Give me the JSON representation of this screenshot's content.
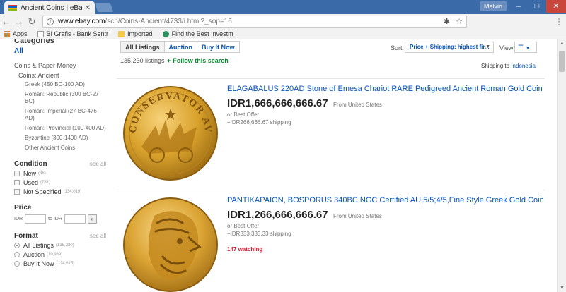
{
  "browser": {
    "tab_title": "Ancient Coins | eBay",
    "profile_name": "Melvin",
    "url_host": "www.ebay.com",
    "url_path": "/sch/Coins-Ancient/4733/i.html?_sop=16",
    "bookmarks": [
      {
        "label": "Apps"
      },
      {
        "label": "BI Grafis - Bank Sentr"
      },
      {
        "label": "Imported"
      },
      {
        "label": "Find the Best Investm"
      }
    ]
  },
  "sidebar": {
    "heading": "Categories",
    "all_label": "All",
    "category": "Coins & Paper Money",
    "subcategory": "Coins: Ancient",
    "subitems": [
      "Greek (450 BC-100 AD)",
      "Roman: Republic (300 BC-27 BC)",
      "Roman: Imperial (27 BC-476 AD)",
      "Roman: Provincial (100-400 AD)",
      "Byzantine (300-1400 AD)",
      "Other Ancient Coins"
    ],
    "condition": {
      "title": "Condition",
      "see_all": "see all",
      "options": [
        {
          "label": "New",
          "count": "(36)"
        },
        {
          "label": "Used",
          "count": "(781)"
        },
        {
          "label": "Not Specified",
          "count": "(134,019)"
        }
      ]
    },
    "price": {
      "title": "Price",
      "from_label": "IDR",
      "to_label": "to IDR"
    },
    "format": {
      "title": "Format",
      "see_all": "see all",
      "options": [
        {
          "label": "All Listings",
          "count": "(135,230)"
        },
        {
          "label": "Auction",
          "count": "(10,969)"
        },
        {
          "label": "Buy It Now",
          "count": "(124,615)"
        }
      ]
    }
  },
  "results": {
    "tabs": [
      "All Listings",
      "Auction",
      "Buy It Now"
    ],
    "count_text": "135,230 listings",
    "follow_text": "Follow this search",
    "sort_label": "Sort:",
    "sort_value": "Price + Shipping: highest fir...",
    "view_label": "View:",
    "ship_to_label": "Shipping to",
    "ship_to_value": "Indonesia"
  },
  "items": [
    {
      "title": "ELAGABALUS 220AD Stone of Emesa Chariot RARE Pedigreed Ancient Roman Gold Coin",
      "price": "IDR1,666,666,666.67",
      "offer": "or Best Offer",
      "shipping": "+IDR266,666.67 shipping",
      "from": "From United States",
      "watching": "",
      "coin_legend": "CONSERVATOR AVG"
    },
    {
      "title": "PANTIKAPAION, BOSPORUS 340BC NGC Certified AU,5/5;4/5,Fine Style Greek Gold Coin",
      "price": "IDR1,266,666,666.67",
      "offer": "or Best Offer",
      "shipping": "+IDR333,333.33 shipping",
      "from": "From United States",
      "watching": "147 watching"
    }
  ],
  "colors": {
    "link": "#0654ba",
    "title_bar": "#3b6aa8",
    "watch_red": "#dd1e31",
    "follow_green": "#0a8a2f",
    "gold": "#d9a22c"
  }
}
